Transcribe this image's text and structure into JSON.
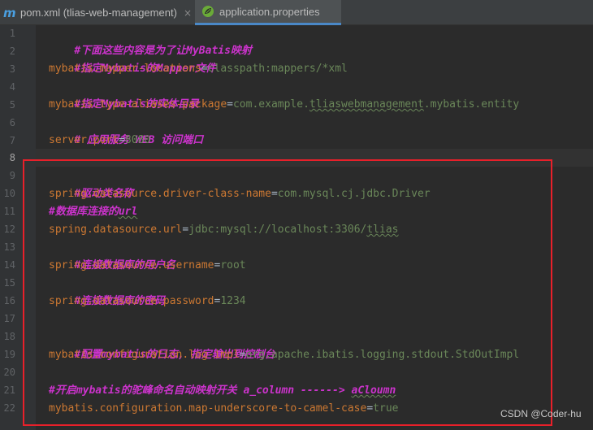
{
  "tabs": [
    {
      "icon": "maven-m-icon",
      "label": "pom.xml (tlias-web-management)",
      "close": "×"
    },
    {
      "icon": "spring-leaf-icon",
      "label": "application.properties"
    }
  ],
  "line_numbers": [
    "1",
    "2",
    "3",
    "4",
    "5",
    "6",
    "7",
    "8",
    "9",
    "10",
    "11",
    "12",
    "13",
    "14",
    "15",
    "16",
    "17",
    "18",
    "19",
    "20",
    "21",
    "22"
  ],
  "lines": {
    "l1": {
      "comment": "#下面这些内容是为了让MyBatis映射"
    },
    "l2": {
      "comment": "#指定Mybatis的Mapper文件"
    },
    "l3": {
      "key": "mybatis.mapper-locations",
      "value": "classpath:mappers/*xml"
    },
    "l4": {
      "comment": "#指定Mybatis的实体目录"
    },
    "l5": {
      "key": "mybatis.type-aliases-package",
      "value_pre": "com.example.",
      "value_sq": "tliaswebmanagement",
      "value_post": ".mybatis.entity"
    },
    "l6": {
      "comment": "# 应用服务 WEB 访问端口"
    },
    "l7": {
      "key": "server.port",
      "value": "8080"
    },
    "l9": {
      "comment": "#驱动类名称"
    },
    "l10": {
      "key": "spring.datasource.driver-class-name",
      "value": "com.mysql.cj.jdbc.Driver"
    },
    "l11": {
      "comment_pre": "#数据库连接的",
      "comment_sq": "url"
    },
    "l12": {
      "key": "spring.datasource.url",
      "value_pre": "jdbc:mysql://localhost:3306/",
      "value_sq": "tlias"
    },
    "l13": {
      "comment": "#连接数据库的用户名"
    },
    "l14": {
      "key": "spring.datasource.username",
      "value": "root"
    },
    "l15": {
      "comment": "#连接数据库的密码"
    },
    "l16": {
      "key": "spring.datasource.password",
      "value": "1234"
    },
    "l18": {
      "comment": "#配置mybatis的日志, 指定输出到控制台"
    },
    "l19": {
      "key": "mybatis.configuration.log-impl",
      "value": "org.apache.ibatis.logging.stdout.StdOutImpl"
    },
    "l21": {
      "comment_pre": "#开启mybatis的驼峰命名自动映射开关 a_column ------> ",
      "comment_sq": "aCloumn"
    },
    "l22": {
      "key": "mybatis.configuration.map-underscore-to-camel-case",
      "value": "true"
    }
  },
  "eq": "=",
  "watermark": "CSDN @Coder-hu",
  "colors": {
    "background": "#2b2b2b",
    "gutter": "#313335",
    "comment": "#cc33cc",
    "key": "#cc7832",
    "value": "#6a8759",
    "highlight_box": "#e8202a",
    "active_tab_underline": "#4a88c7"
  }
}
